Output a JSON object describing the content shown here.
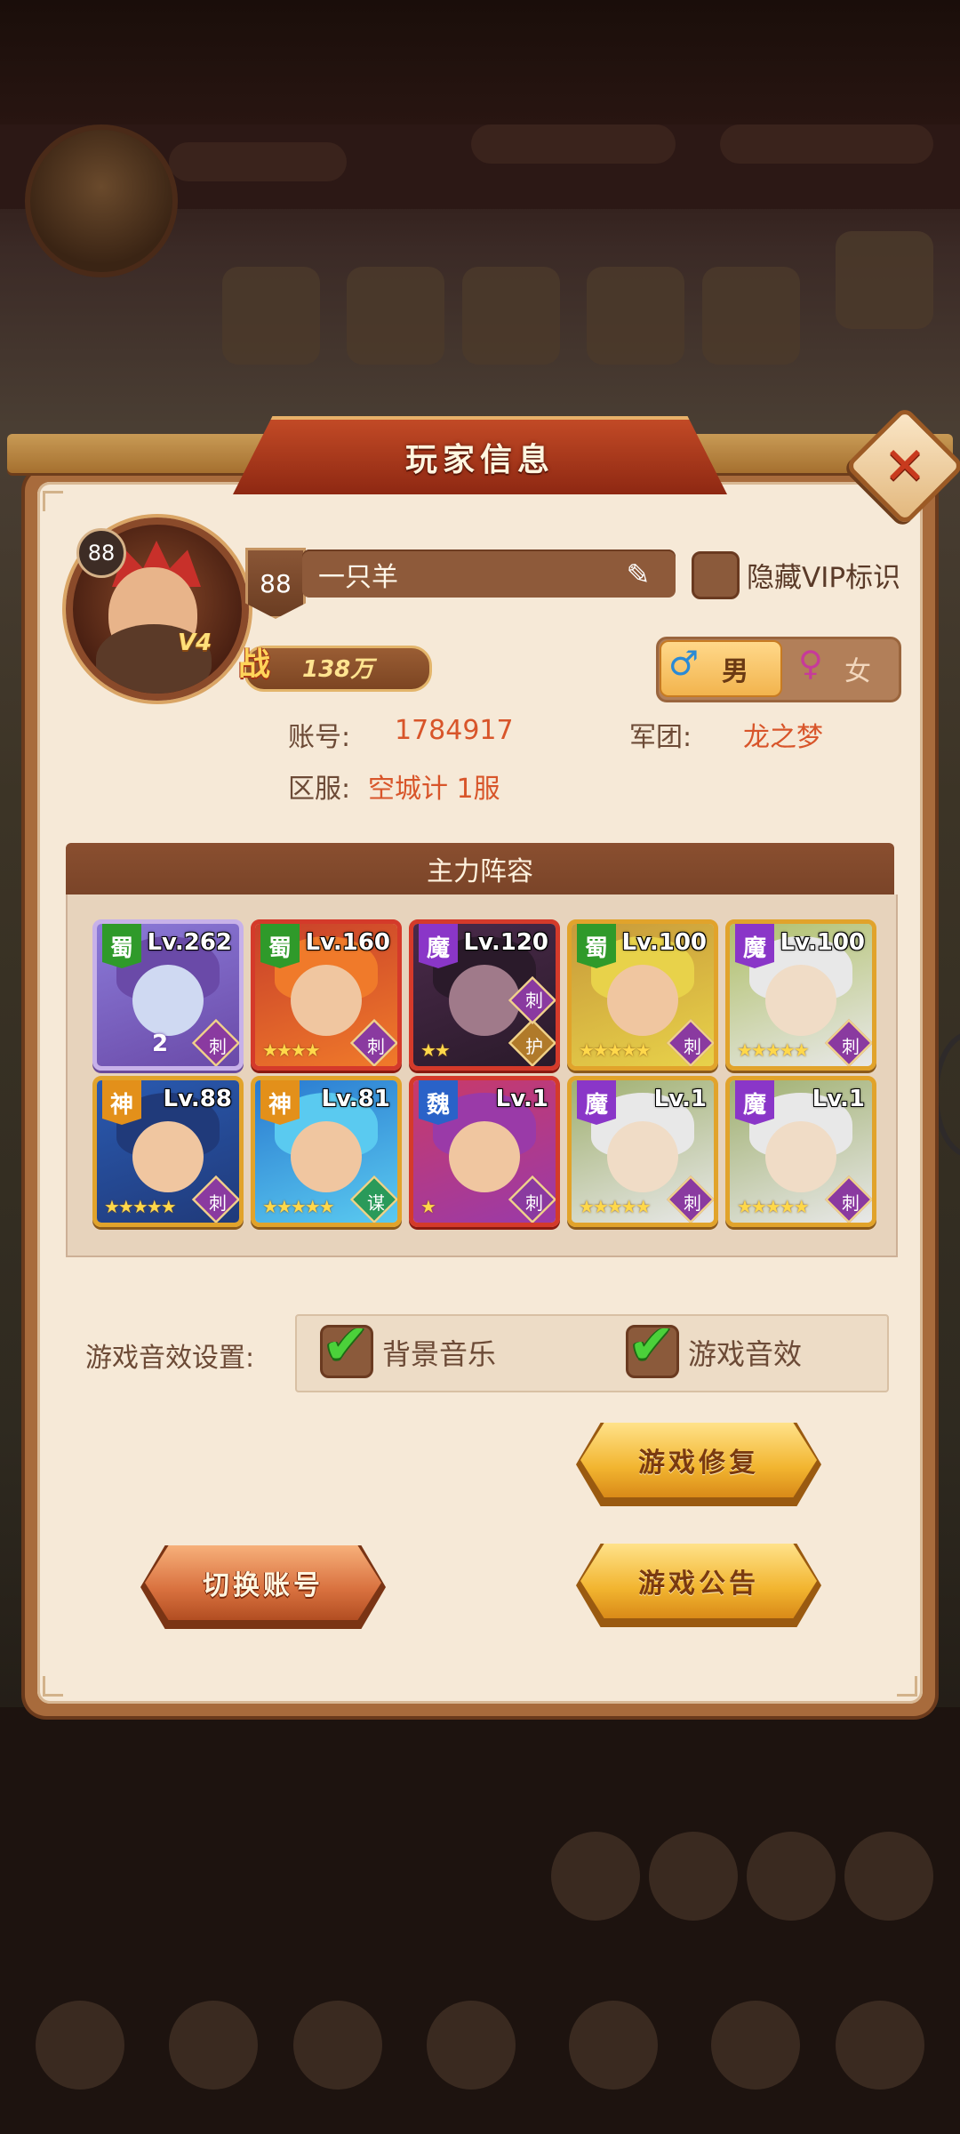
{
  "dialog": {
    "title": "玩家信息",
    "close_icon": "close-icon"
  },
  "profile": {
    "avatar_level": "88",
    "vip": "V4",
    "level": "88",
    "name": "一只羊",
    "hide_vip_label": "隐藏VIP标识",
    "power_icon": "战",
    "power": "138万",
    "gender": {
      "male_icon": "♂",
      "male_label": "男",
      "female_icon": "♀",
      "female_label": "女",
      "selected": "male"
    },
    "account_label": "账号:",
    "account_value": "1784917",
    "legion_label": "军团:",
    "legion_value": "龙之梦",
    "server_label": "区服:",
    "server_value": "空城计 1服"
  },
  "lineup": {
    "title": "主力阵容",
    "heroes": [
      {
        "faction": "蜀",
        "level": "Lv.262",
        "stars": "",
        "role": "刺",
        "extra": "2"
      },
      {
        "faction": "蜀",
        "level": "Lv.160",
        "stars": "★★★★",
        "role": "刺",
        "extra": ""
      },
      {
        "faction": "魔",
        "level": "Lv.120",
        "stars": "★★",
        "role": "护",
        "role2": "刺",
        "extra": ""
      },
      {
        "faction": "蜀",
        "level": "Lv.100",
        "stars": "★★★★★",
        "role": "刺",
        "extra": ""
      },
      {
        "faction": "魔",
        "level": "Lv.100",
        "stars": "★★★★★",
        "role": "刺",
        "extra": ""
      },
      {
        "faction": "神",
        "level": "Lv.88",
        "stars": "★★★★★",
        "role": "刺",
        "extra": ""
      },
      {
        "faction": "神",
        "level": "Lv.81",
        "stars": "★★★★★",
        "role": "谋",
        "extra": ""
      },
      {
        "faction": "魏",
        "level": "Lv.1",
        "stars": "★",
        "role": "刺",
        "extra": ""
      },
      {
        "faction": "魔",
        "level": "Lv.1",
        "stars": "★★★★★",
        "role": "刺",
        "extra": ""
      },
      {
        "faction": "魔",
        "level": "Lv.1",
        "stars": "★★★★★",
        "role": "刺",
        "extra": ""
      }
    ]
  },
  "settings": {
    "label": "游戏音效设置:",
    "bgm_label": "背景音乐",
    "bgm_checked": true,
    "sfx_label": "游戏音效",
    "sfx_checked": true,
    "check_mark": "✔"
  },
  "buttons": {
    "repair": "游戏修复",
    "switch_account": "切换账号",
    "notice": "游戏公告"
  },
  "colors": {
    "faction_shu": "#2f9a2a",
    "faction_mo": "#8a36c8",
    "faction_shen": "#e3901a",
    "faction_wei": "#2a62c8",
    "accent_value": "#d8552a"
  }
}
